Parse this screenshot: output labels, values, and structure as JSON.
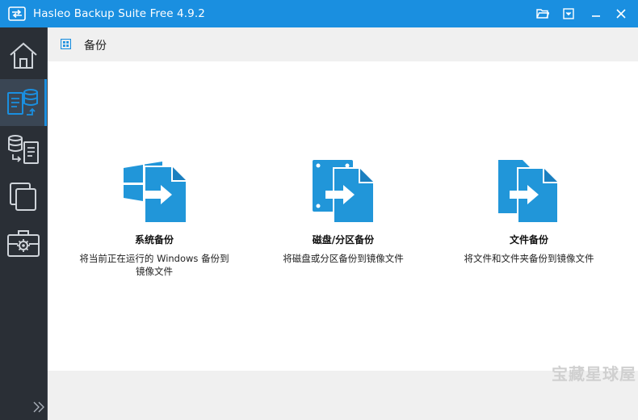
{
  "window": {
    "title": "Hasleo Backup Suite Free 4.9.2",
    "accent_color": "#1a8fe0",
    "titlebar_icons": [
      "app-logo-icon",
      "folder-open-icon",
      "dropdown-menu-icon",
      "minimize-icon",
      "close-icon"
    ]
  },
  "sidebar": {
    "items": [
      {
        "name": "home",
        "icon": "home-icon"
      },
      {
        "name": "backup",
        "icon": "backup-icon",
        "active": true
      },
      {
        "name": "restore",
        "icon": "restore-icon"
      },
      {
        "name": "clone",
        "icon": "clone-icon"
      },
      {
        "name": "tools",
        "icon": "toolbox-icon"
      }
    ],
    "expand_icon": "double-chevron-right-icon"
  },
  "header": {
    "title": "备份",
    "icon": "grid-icon"
  },
  "options": [
    {
      "title": "系统备份",
      "desc_line1": "将当前正在运行的 Windows 备份到",
      "desc_line2": "镜像文件",
      "icon": "windows-to-file-icon"
    },
    {
      "title": "磁盘/分区备份",
      "desc_line1": "将磁盘或分区备份到镜像文件",
      "desc_line2": "",
      "icon": "disk-to-file-icon"
    },
    {
      "title": "文件备份",
      "desc_line1": "将文件和文件夹备份到镜像文件",
      "desc_line2": "",
      "icon": "files-to-file-icon"
    }
  ],
  "watermark": "宝藏星球屋"
}
